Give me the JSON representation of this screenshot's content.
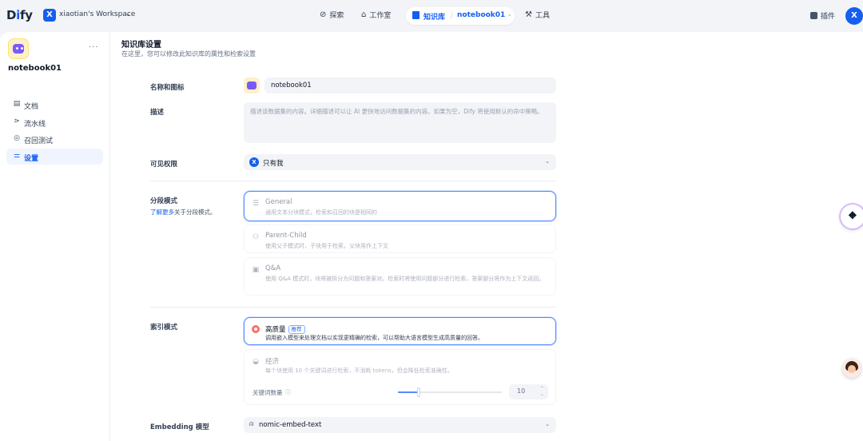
{
  "app": {
    "logo": "Dify",
    "workspace_initial": "X",
    "workspace_name": "xiaotian's Workspace"
  },
  "nav": {
    "explore": "探索",
    "studio": "工作室",
    "knowledge": "知识库",
    "current_dataset": "notebook01",
    "tools": "工具",
    "plugins": "插件",
    "user_initial": "X"
  },
  "sidebar": {
    "dataset_name": "notebook01",
    "more": "···",
    "items": [
      {
        "label": "文档"
      },
      {
        "label": "流水线"
      },
      {
        "label": "召回测试"
      },
      {
        "label": "设置"
      }
    ]
  },
  "page": {
    "title": "知识库设置",
    "description": "在这里，您可以修改此知识库的属性和检索设置"
  },
  "form": {
    "name_label": "名称和图标",
    "name_value": "notebook01",
    "desc_label": "描述",
    "desc_placeholder": "描述该数据集的内容。详细描述可以让 AI 更快地访问数据集的内容。如果为空，Dify 将使用默认的命中策略。",
    "permission_label": "可见权限",
    "permission_avatar": "X",
    "permission_value": "只有我",
    "chunk_label": "分段模式",
    "chunk_learn_link": "了解更多",
    "chunk_learn_suffix": "关于分段模式。",
    "chunk_options": [
      {
        "title": "General",
        "desc": "通用文本分块模式，检索和召回的块是相同的"
      },
      {
        "title": "Parent-Child",
        "desc": "使用父子模式时，子块用于检索，父块用作上下文"
      },
      {
        "title": "Q&A",
        "desc": "使用 Q&A 模式时，块将被拆分为问题和答案对。检索时将使用问题部分进行检索，答案部分将作为上下文返回。"
      }
    ],
    "index_label": "索引模式",
    "index_options": [
      {
        "title": "高质量",
        "badge": "推荐",
        "desc": "调用嵌入模型来处理文档以实现更精确的检索，可以帮助大语言模型生成高质量的回答。"
      },
      {
        "title": "经济",
        "desc": "每个块使用 10 个关键词进行检索，不消耗 tokens，但会降低检索准确性。"
      }
    ],
    "keyword_label": "关键词数量",
    "keyword_help": "ⓘ",
    "keyword_value": "10",
    "keyword_slider_fraction": 0.2,
    "embedding_label": "Embedding 模型",
    "embedding_value": "nomic-embed-text"
  },
  "colors": {
    "accent": "#155eef",
    "selected_border": "#528bff"
  }
}
